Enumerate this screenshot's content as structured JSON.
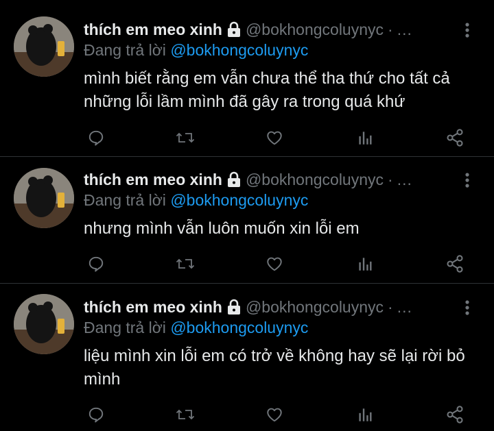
{
  "tweets": [
    {
      "name": "thích em meo xinh",
      "handle": "@bokhongcoluynyc",
      "dot": "·",
      "ellipsis": "...",
      "reply_prefix": "Đang trả lời",
      "reply_to": "@bokhongcoluynyc",
      "text": "mình biết rằng em vẫn chưa thể tha thứ cho tất cả những lỗi lầm mình đã gây ra trong quá khứ"
    },
    {
      "name": "thích em meo xinh",
      "handle": "@bokhongcoluynyc",
      "dot": "·",
      "ellipsis": "...",
      "reply_prefix": "Đang trả lời",
      "reply_to": "@bokhongcoluynyc",
      "text": "nhưng mình vẫn luôn muốn xin lỗi em"
    },
    {
      "name": "thích em meo xinh",
      "handle": "@bokhongcoluynyc",
      "dot": "·",
      "ellipsis": "...",
      "reply_prefix": "Đang trả lời",
      "reply_to": "@bokhongcoluynyc",
      "text": "liệu mình xin lỗi em có trở về không hay sẽ lại rời bỏ mình"
    }
  ],
  "icons": {
    "lock": "lock-icon",
    "more": "more-vertical-icon",
    "reply": "comment-icon",
    "retweet": "retweet-icon",
    "like": "heart-icon",
    "stats": "analytics-icon",
    "share": "share-icon"
  },
  "colors": {
    "background": "#000000",
    "text": "#e7e9ea",
    "muted": "#71767b",
    "accent": "#1d9bf0",
    "divider": "#2f3336"
  }
}
